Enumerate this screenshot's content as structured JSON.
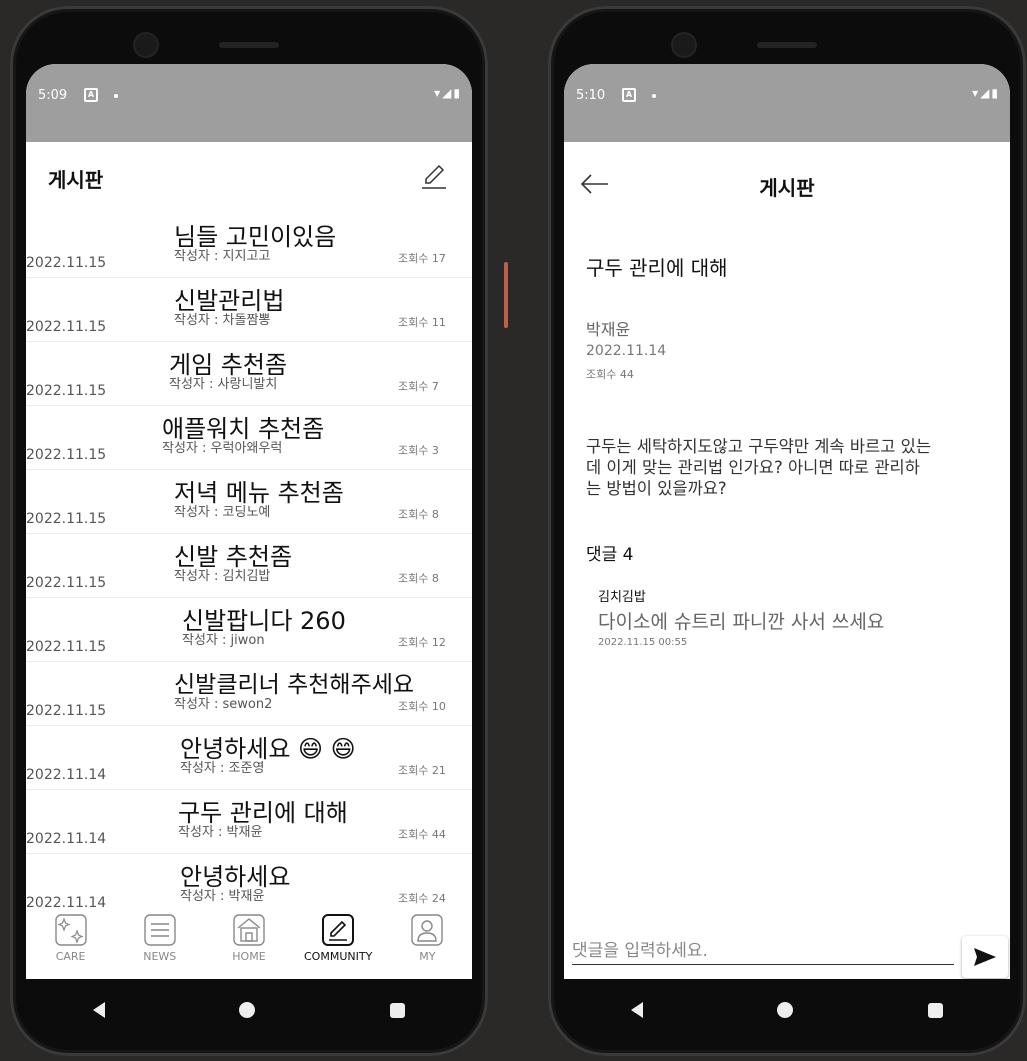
{
  "left_screen": {
    "status": {
      "time": "5:09",
      "notification_icon": "A"
    },
    "title": "게시판",
    "posts": [
      {
        "date": "2022.11.15",
        "title": "님들 고민이있음",
        "author": "작성자 : 지지고고",
        "views": "조회수 17"
      },
      {
        "date": "2022.11.15",
        "title": "신발관리법",
        "author": "작성자 : 차돌짬뽕",
        "views": "조회수 11"
      },
      {
        "date": "2022.11.15",
        "title": "게임 추천좀",
        "author": "작성자 : 사랑니발치",
        "views": "조회수 7"
      },
      {
        "date": "2022.11.15",
        "title": "애플워치 추천좀",
        "author": "작성자 : 우럭아왜우럭",
        "views": "조회수 3"
      },
      {
        "date": "2022.11.15",
        "title": "저녁 메뉴 추천좀",
        "author": "작성자 : 코딩노예",
        "views": "조회수 8"
      },
      {
        "date": "2022.11.15",
        "title": "신발 추천좀",
        "author": "작성자 : 김치김밥",
        "views": "조회수 8"
      },
      {
        "date": "2022.11.15",
        "title": "신발팝니다 260",
        "author": "작성자 : jiwon",
        "views": "조회수 12"
      },
      {
        "date": "2022.11.15",
        "title": "신발클리너 추천해주세요",
        "author": "작성자 : sewon2",
        "views": "조회수 10"
      },
      {
        "date": "2022.11.14",
        "title": "안녕하세요 😄 😄",
        "author": "작성자 : 조준영",
        "views": "조회수 21"
      },
      {
        "date": "2022.11.14",
        "title": "구두 관리에 대해",
        "author": "작성자 : 박재윤",
        "views": "조회수 44"
      },
      {
        "date": "2022.11.14",
        "title": "안녕하세요",
        "author": "작성자 : 박재윤",
        "views": "조회수 24"
      }
    ],
    "tabs": [
      {
        "label": "CARE",
        "icon": "sparkle-icon"
      },
      {
        "label": "NEWS",
        "icon": "news-icon"
      },
      {
        "label": "HOME",
        "icon": "home-icon"
      },
      {
        "label": "COMMUNITY",
        "icon": "pencil-icon",
        "active": true
      },
      {
        "label": "MY",
        "icon": "person-icon"
      }
    ]
  },
  "right_screen": {
    "status": {
      "time": "5:10",
      "notification_icon": "A"
    },
    "title": "게시판",
    "post": {
      "title": "구두 관리에 대해",
      "author": "박재윤",
      "date": "2022.11.14",
      "views": "조회수  44",
      "body_lines": [
        "구두는 세탁하지도않고 구두약만 계속 바르고 있는",
        "데 이게 맞는 관리법 인가요? 아니면 따로 관리하",
        "는 방법이 있을까요?"
      ]
    },
    "comments_label": "댓글 4",
    "comments": [
      {
        "author": "김치김밥",
        "text": "다이소에 슈트리 파니깐 사서 쓰세요",
        "date": "2022.11.15 00:55"
      }
    ],
    "comment_input_placeholder": "댓글을 입력하세요."
  },
  "colors": {
    "status_bar": "#9e9e9e",
    "side_button": "#c0604a",
    "background": "#2b2828"
  }
}
